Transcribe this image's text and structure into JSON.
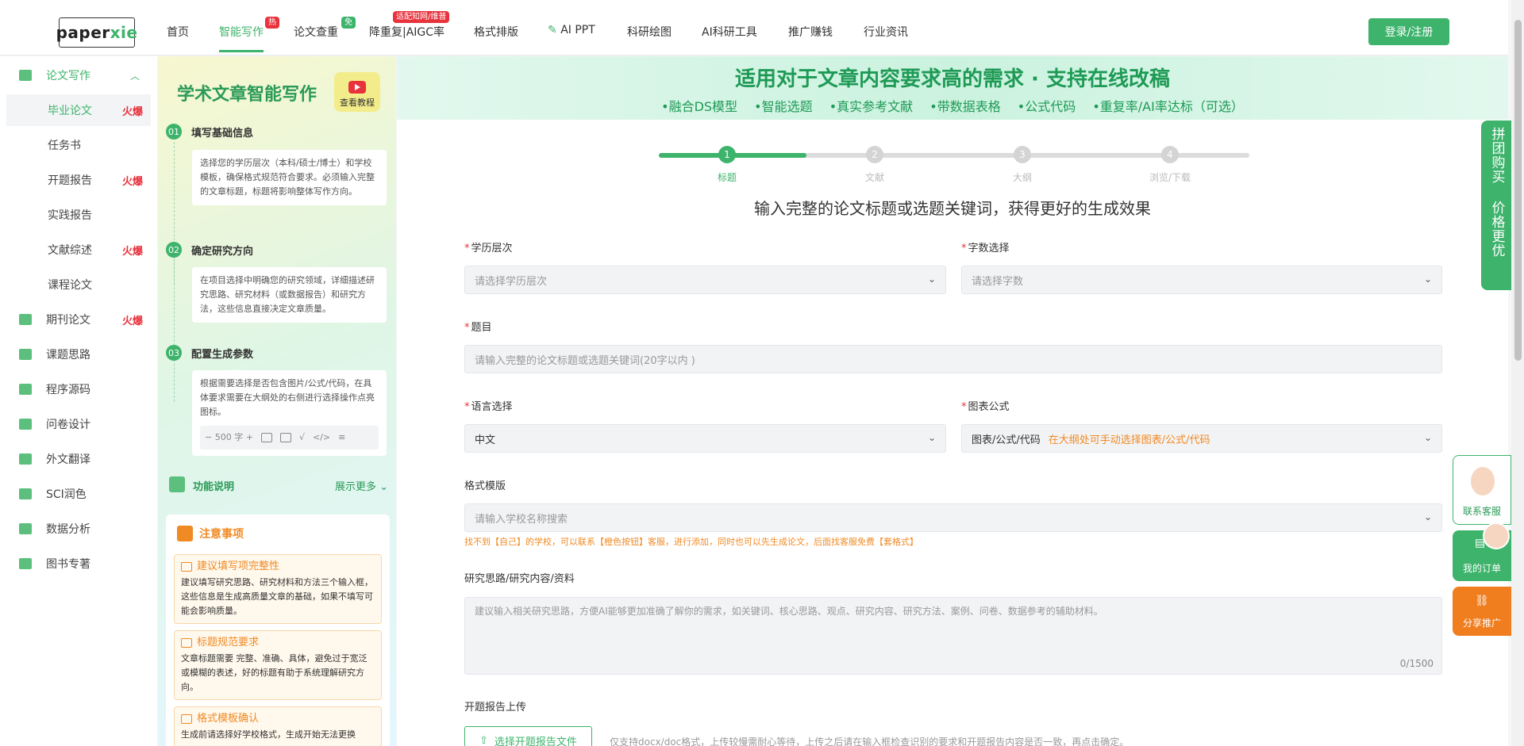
{
  "nav": {
    "logo_pre": "paper",
    "logo_post": "xie",
    "items": [
      {
        "label": "首页",
        "active": false
      },
      {
        "label": "智能写作",
        "active": true,
        "badge": "热"
      },
      {
        "label": "论文查重",
        "badge": "免"
      },
      {
        "label": "降重复|AIGC率",
        "badge": "适配知网/维普"
      },
      {
        "label": "格式排版"
      },
      {
        "label": "AI PPT"
      },
      {
        "label": "科研绘图"
      },
      {
        "label": "AI科研工具"
      },
      {
        "label": "推广赚钱"
      },
      {
        "label": "行业资讯"
      }
    ],
    "login": "登录/注册"
  },
  "sidebar": {
    "section": "论文写作",
    "items": [
      {
        "label": "毕业论文",
        "hot": "火爆",
        "active": true
      },
      {
        "label": "任务书"
      },
      {
        "label": "开题报告",
        "hot": "火爆"
      },
      {
        "label": "实践报告"
      },
      {
        "label": "文献综述",
        "hot": "火爆"
      },
      {
        "label": "课程论文"
      },
      {
        "label": "期刊论文",
        "hot": "火爆",
        "icon": "journal-icon"
      },
      {
        "label": "课题思路",
        "icon": "idea-icon"
      },
      {
        "label": "程序源码",
        "icon": "code-icon"
      },
      {
        "label": "问卷设计",
        "icon": "survey-icon"
      },
      {
        "label": "外文翻译",
        "icon": "translate-icon"
      },
      {
        "label": "SCI润色",
        "icon": "sci-icon"
      },
      {
        "label": "数据分析",
        "icon": "chart-icon"
      },
      {
        "label": "图书专著",
        "icon": "book-icon"
      }
    ]
  },
  "guide": {
    "title": "学术文章智能写作",
    "tutorial": "查看教程",
    "steps": [
      {
        "num": "01",
        "title": "填写基础信息",
        "text": "选择您的学历层次（本科/硕士/博士）和学校模板，确保格式规范符合要求。必须输入完整的文章标题，标题将影响整体写作方向。"
      },
      {
        "num": "02",
        "title": "确定研究方向",
        "text": "在项目选择中明确您的研究领域，详细描述研究思路、研究材料（或数据报告）和研究方法，这些信息直接决定文章质量。"
      },
      {
        "num": "03",
        "title": "配置生成参数",
        "text": "根据需要选择是否包含图片/公式/代码，在具体要求需要在大纲处的右侧进行选择操作点亮图标。"
      }
    ],
    "toolbar_words": "500 字",
    "func_label": "功能说明",
    "func_more": "展示更多",
    "notes_title": "注意事项",
    "notes": [
      {
        "title": "建议填写项完整性",
        "text": "建议填写研究思路、研究材料和方法三个输入框，这些信息是生成高质量文章的基础，如果不填写可能会影响质量。"
      },
      {
        "title": "标题规范要求",
        "text": "文章标题需要 完整、准确、具体，避免过于宽泛或模糊的表述，好的标题有助于系统理解研究方向。"
      },
      {
        "title": "格式模板确认",
        "text": "生成前请选择好学校格式，生成开始无法更换"
      }
    ]
  },
  "banner": {
    "title": "适用对于文章内容要求高的需求 · 支持在线改稿",
    "features": [
      "•融合DS模型",
      "•智能选题",
      "•真实参考文献",
      "•带数据表格",
      "•公式代码",
      "•重复率/AI率达标（可选）"
    ]
  },
  "progress": {
    "current_step": 1,
    "steps": [
      {
        "num": "1",
        "label": "标题"
      },
      {
        "num": "2",
        "label": "文献"
      },
      {
        "num": "3",
        "label": "大纲"
      },
      {
        "num": "4",
        "label": "浏览/下载"
      }
    ]
  },
  "form": {
    "hint": "输入完整的论文标题或选题关键词，获得更好的生成效果",
    "education": {
      "label": "学历层次",
      "placeholder": "请选择学历层次"
    },
    "word_count": {
      "label": "字数选择",
      "placeholder": "请选择字数"
    },
    "title": {
      "label": "题目",
      "placeholder": "请输入完整的论文标题或选题关键词(20字以内 )"
    },
    "language": {
      "label": "语言选择",
      "value": "中文"
    },
    "chart": {
      "label": "图表公式",
      "value": "图表/公式/代码",
      "note": "在大纲处可手动选择图表/公式/代码"
    },
    "template": {
      "label": "格式模版",
      "placeholder": "请输入学校名称搜索",
      "tip": "找不到【自己】的学校，可以联系【橙色按钮】客服，进行添加，同时也可以先生成论文，后面找客服免费【套格式】"
    },
    "research": {
      "label": "研究思路/研究内容/资料",
      "placeholder": "建议输入相关研究思路，方便AI能够更加准确了解你的需求，如关键词、核心思路、观点、研究内容、研究方法、案例、问卷、数据参考的辅助材料。",
      "counter": "0/1500"
    },
    "upload": {
      "label": "开题报告上传",
      "button": "选择开题报告文件",
      "tip": "仅支持docx/doc格式，上传较慢需耐心等待，上传之后请在输入框检查识别的要求和开题报告内容是否一致，再点击确定。"
    }
  },
  "floating": {
    "group_buy": "拼团购买 价格更优",
    "service": "联系客服",
    "orders": "我的订单",
    "share": "分享推广"
  }
}
